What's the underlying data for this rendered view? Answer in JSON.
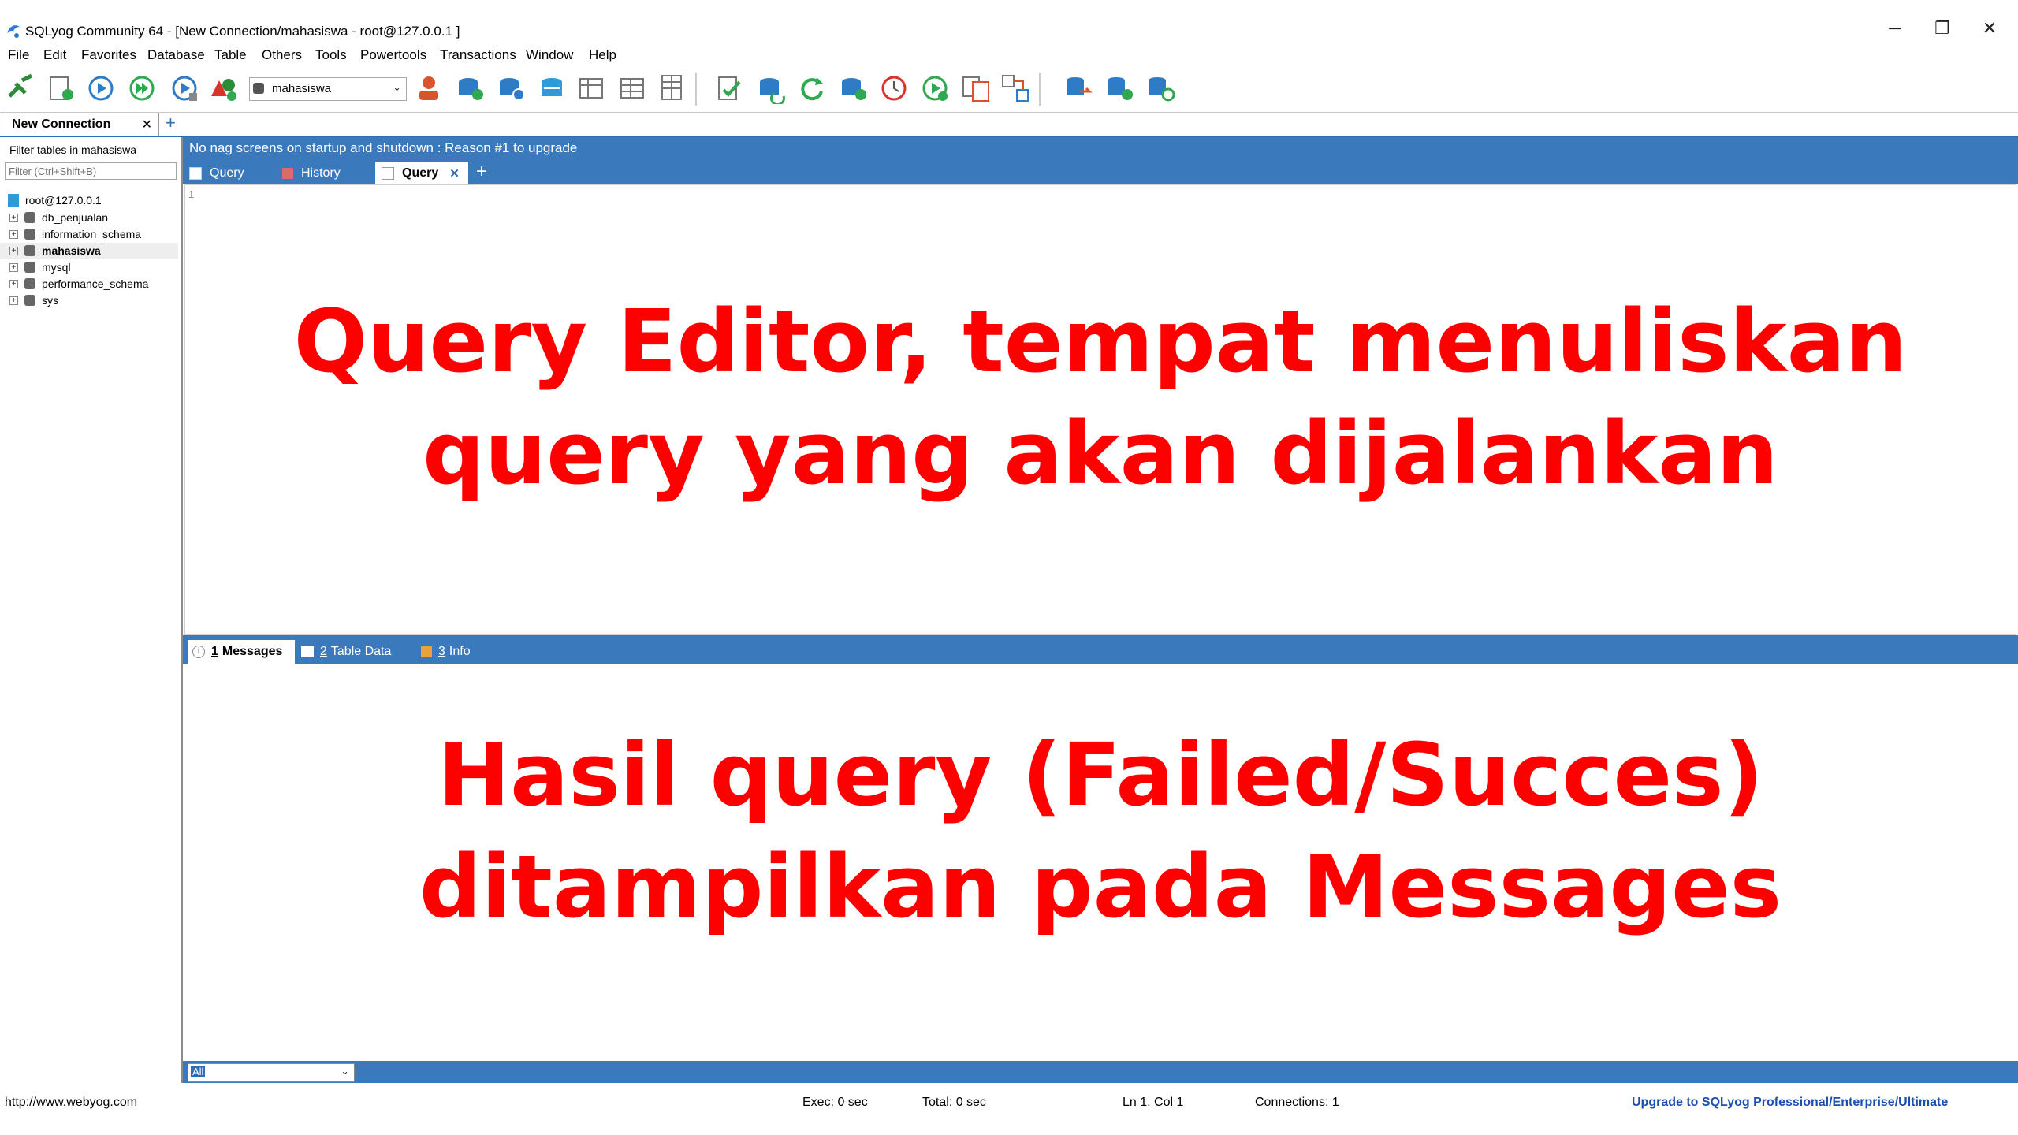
{
  "window": {
    "title": "SQLyog Community 64 - [New Connection/mahasiswa - root@127.0.0.1 ]",
    "minimize_glyph": "─",
    "restore_glyph": "❐",
    "close_glyph": "✕"
  },
  "menu": [
    "File",
    "Edit",
    "Favorites",
    "Database",
    "Table",
    "Others",
    "Tools",
    "Powertools",
    "Transactions",
    "Window",
    "Help"
  ],
  "toolbar": {
    "database_select": "mahasiswa"
  },
  "connection_tab": {
    "label": "New Connection",
    "close_glyph": "✕",
    "add_glyph": "+"
  },
  "left_panel": {
    "filter_label": "Filter tables in mahasiswa",
    "filter_placeholder": "Filter (Ctrl+Shift+B)",
    "root": "root@127.0.0.1",
    "databases": [
      "db_penjualan",
      "information_schema",
      "mahasiswa",
      "mysql",
      "performance_schema",
      "sys"
    ],
    "selected": "mahasiswa"
  },
  "nag_text": "No nag screens on startup and shutdown : Reason #1 to upgrade",
  "query_tabs": {
    "tab1": "Query",
    "tab2": "History",
    "tab3": "Query",
    "close_glyph": "✕",
    "add_glyph": "+"
  },
  "editor": {
    "line_number": "1"
  },
  "result_tabs": {
    "messages_num": "1",
    "messages": "Messages",
    "tabledata_num": "2",
    "tabledata": "Table Data",
    "info_num": "3",
    "info": "Info"
  },
  "bottom_select": "All",
  "status": {
    "url": "http://www.webyog.com",
    "exec": "Exec: 0 sec",
    "total": "Total: 0 sec",
    "position": "Ln 1, Col 1",
    "connections": "Connections: 1",
    "upgrade": "Upgrade to SQLyog Professional/Enterprise/Ultimate"
  },
  "annotations": {
    "editor_line1": "Query Editor, tempat menuliskan",
    "editor_line2": "query yang akan dijalankan",
    "result_line1": "Hasil query (Failed/Succes)",
    "result_line2": "ditampilkan pada Messages"
  },
  "colors": {
    "panel_blue": "#3b79bd",
    "annotation_red": "#ff0000"
  }
}
